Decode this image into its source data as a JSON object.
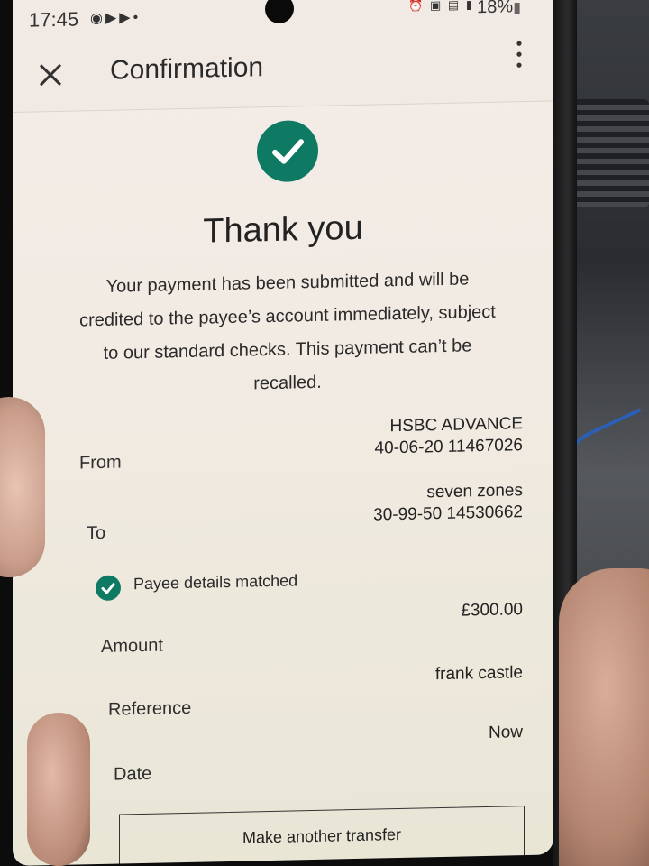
{
  "status_bar": {
    "time": "17:45",
    "left_icons": [
      "messenger-icon",
      "youtube-icon",
      "video-icon",
      "dot-icon"
    ],
    "right_icons": [
      "alarm-icon",
      "volte-icon",
      "5g-icon",
      "signal-icon"
    ],
    "battery": "18%"
  },
  "app_bar": {
    "title": "Confirmation"
  },
  "confirmation": {
    "heading": "Thank you",
    "message": "Your payment has been submitted and will be credited to the payee’s account immediately, subject to our standard checks. This payment can’t be recalled."
  },
  "details": {
    "from_label": "From",
    "from_name": "HSBC ADVANCE",
    "from_account": "40-06-20 11467026",
    "to_label": "To",
    "to_name": "seven zones",
    "to_account": "30-99-50 14530662",
    "payee_match": "Payee details matched",
    "amount_label": "Amount",
    "amount_value": "£300.00",
    "reference_label": "Reference",
    "reference_value": "frank castle",
    "date_label": "Date",
    "date_value": "Now"
  },
  "actions": {
    "another_transfer": "Make another transfer"
  },
  "colors": {
    "accent_green": "#0e7a63",
    "screen_bg": "#f2ebe4"
  }
}
